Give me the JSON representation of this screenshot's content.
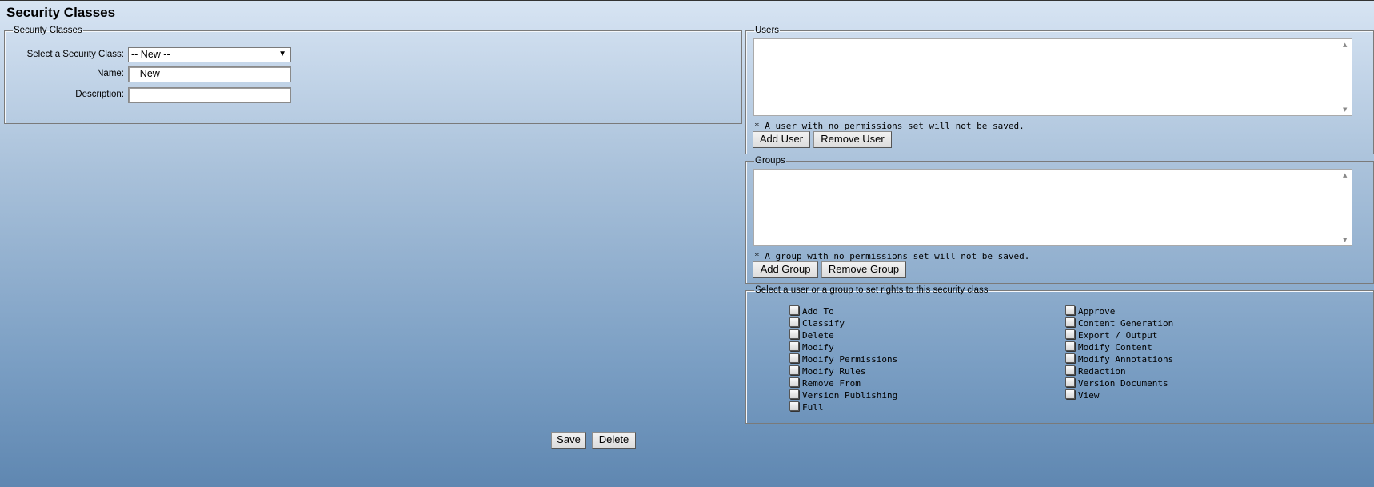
{
  "page": {
    "title": "Security Classes"
  },
  "security_panel": {
    "legend": "Security Classes",
    "select_label": "Select a Security Class:",
    "select_value": "-- New --",
    "name_label": "Name:",
    "name_value": "-- New --",
    "description_label": "Description:",
    "description_value": ""
  },
  "users_panel": {
    "legend": "Users",
    "note": "* A user with no permissions set will not be saved.",
    "add_label": "Add User",
    "remove_label": "Remove User"
  },
  "groups_panel": {
    "legend": "Groups",
    "note": "* A group with no permissions set will not be saved.",
    "add_label": "Add Group",
    "remove_label": "Remove Group"
  },
  "rights_panel": {
    "legend": "Select a user or a group to set rights to this security class",
    "left": [
      "Add To",
      "Classify",
      "Delete",
      "Modify",
      "Modify Permissions",
      "Modify Rules",
      "Remove From",
      "Version Publishing",
      "Full"
    ],
    "right": [
      "Approve",
      "Content Generation",
      "Export / Output",
      "Modify Content",
      "Modify Annotations",
      "Redaction",
      "Version Documents",
      "View"
    ]
  },
  "footer": {
    "save_label": "Save",
    "delete_label": "Delete"
  }
}
